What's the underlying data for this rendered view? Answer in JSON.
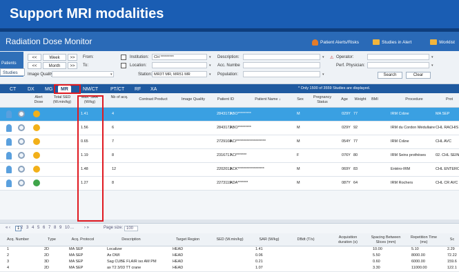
{
  "banner": {
    "title": "Support MRI modalities"
  },
  "app": {
    "title": "Radiation Dose Monitor",
    "top_buttons": [
      {
        "label": "Patient Alerts/Risks",
        "icon": "alert-person-icon"
      },
      {
        "label": "Studies in Alert",
        "icon": "folder-icon"
      },
      {
        "label": "Worklist",
        "icon": "folder-icon"
      }
    ]
  },
  "filters": {
    "patients_tab": "Patients",
    "studies_tab": "Studies",
    "nav": {
      "prev": "<<",
      "next": ">>",
      "week": "Week",
      "month": "Month"
    },
    "from_label": "From:",
    "to_label": "To:",
    "institution_label": "Institution:",
    "institution_value": "CH *********",
    "location_label": "Location:",
    "station_label": "Station:",
    "station_value": "MR3T MR, MR51 MR",
    "image_quality_label": "Image Quality:",
    "description_label": "Description:",
    "acc_number_label": "Acc. Numbe",
    "population_label": "Population:",
    "operator_label": "Operator:",
    "perf_physician_label": "Perf. Physician:",
    "search": "Search",
    "clear": "Clear"
  },
  "modality_tabs": [
    "CT",
    "DX",
    "MG",
    "MR",
    "NM/CT",
    "PT/CT",
    "RF",
    "XA"
  ],
  "active_tab": "MR",
  "notice": "* Only 1500 of 3559 Studies are displayed.",
  "study_headers": {
    "alert_dose": "Alert Dose",
    "total_sed": "Total SED (W.min/kg)",
    "max_sar": "Max. SAR (W/kg)",
    "nb_acq": "Nb of acq.",
    "contrast": "Contrast Product",
    "image_quality": "Image Quality",
    "patient_id": "Patient ID",
    "patient_name": "Patient Name ↓",
    "sex": "Sex",
    "pregnancy": "Pregnancy Status",
    "age": "Age",
    "weight": "Weight",
    "bmi": "BMI",
    "procedure": "Procedure",
    "prot": "Prot"
  },
  "studies": [
    {
      "sar": "1.41",
      "acq": "4",
      "pid": "2843172",
      "name": "ABO*********",
      "sex": "M",
      "age": "029Y",
      "weight": "77",
      "procedure": "IRM Crâne",
      "prot": "MA SEP",
      "dose_color": "#f2b019"
    },
    {
      "sar": "1.56",
      "acq": "6",
      "pid": "2843172",
      "name": "ABO*********",
      "sex": "M",
      "age": "029Y",
      "weight": "92",
      "procedure": "IRM du Cordon Médullaire",
      "prot": "CHL RACHIS",
      "dose_color": "#f2b019"
    },
    {
      "sar": "0.65",
      "acq": "7",
      "pid": "2729108",
      "name": "ACI********************",
      "sex": "M",
      "age": "054Y",
      "weight": "77",
      "procedure": "IRM Crâne",
      "prot": "CHL AVC",
      "dose_color": "#f2b019"
    },
    {
      "sar": "1.19",
      "acq": "8",
      "pid": "2316717",
      "name": "ACI*******",
      "sex": "F",
      "age": "076Y",
      "weight": "80",
      "procedure": "IRM Seins prothèses",
      "prot": "02. CHL SEIN",
      "dose_color": "#f2b019"
    },
    {
      "sar": "1.48",
      "acq": "12",
      "pid": "2202013",
      "name": "ACK******************",
      "sex": "M",
      "age": "069Y",
      "weight": "83",
      "procedure": "Entéro-IRM",
      "prot": "CHL ENTERO",
      "dose_color": "#f2b019"
    },
    {
      "sar": "1.27",
      "acq": "8",
      "pid": "2273119",
      "name": "ADA*******",
      "sex": "M",
      "age": "087Y",
      "weight": "64",
      "procedure": "IRM Rochers",
      "prot": "CHL CR AVC",
      "dose_color": "#3fa54a"
    }
  ],
  "pager": {
    "prev": "« ‹",
    "pages": [
      "1",
      "2",
      "3",
      "4",
      "5",
      "6",
      "7",
      "8",
      "9",
      "10",
      "..."
    ],
    "next": "› »",
    "page_size_label": "Page size:",
    "page_size_value": "100"
  },
  "series_headers": {
    "acq_number": "Acq. Number",
    "type": "Type",
    "protocol": "Acq. Protocol",
    "description": "Description",
    "target": "Target Region",
    "sed": "SED (W.min/kg)",
    "sar": "SAR (W/kg)",
    "dbdt": "DBdt (T/s)",
    "acq_duration": "Acquisition duration (s)",
    "spacing": "Spacing Between Slices (mm)",
    "rep_time": "Repetition Time (ms)",
    "sc": "Sc"
  },
  "series": [
    {
      "n": "1",
      "type": "2D",
      "protocol": "MA SEP",
      "desc": "Localizer",
      "target": "HEAD",
      "sar": "1.41",
      "spacing": "10.00",
      "rep": "5.10",
      "sc": "2.29"
    },
    {
      "n": "2",
      "type": "2D",
      "protocol": "MA SEP",
      "desc": "Ax DWI",
      "target": "HEAD",
      "sar": "0.06",
      "spacing": "5.50",
      "rep": "8000.00",
      "sc": "72.22"
    },
    {
      "n": "3",
      "type": "3D",
      "protocol": "MA SEP",
      "desc": "Sag CUBE FLAIR iso AM PM",
      "target": "HEAD",
      "sar": "0.21",
      "spacing": "0.60",
      "rep": "6000.00",
      "sc": "159.6"
    },
    {
      "n": "4",
      "type": "2D",
      "protocol": "MA SEP",
      "desc": "ax T2 3/03 TT crane",
      "target": "HEAD",
      "sar": "1.07",
      "spacing": "3.30",
      "rep": "11000.00",
      "sc": "122.1"
    }
  ]
}
